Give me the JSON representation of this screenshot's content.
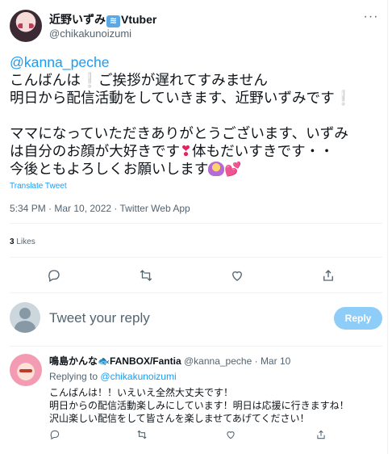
{
  "tweet": {
    "author_name": "近野いずみ",
    "author_suffix": "Vtuber",
    "author_emoji_icon": "water-wave-icon",
    "handle": "@chikakunoizumi",
    "body": {
      "mention": "@kanna_peche",
      "line1_a": "こんばんは",
      "line1_b": "ご挨拶が遅れてすみません",
      "line2_a": "明日から配信活動をしていきます、近野いずみです",
      "line3": "ママになっていただきありがとうございます、いずみ",
      "line4_a": "は自分のお顔が大好きです",
      "line4_b": "体もだいすきです・・",
      "line5": "今後ともよろしくお願いします"
    },
    "translate_label": "Translate Tweet",
    "timestamp": "5:34 PM · Mar 10, 2022 · Twitter Web App",
    "likes_count": "3",
    "likes_label": "Likes"
  },
  "reply_composer": {
    "placeholder": "Tweet your reply",
    "button_label": "Reply"
  },
  "reply": {
    "name": "鳴島かんな",
    "name_suffix": "FANBOX/Fantia",
    "handle": "@kanna_peche",
    "separator": "·",
    "date": "Mar 10",
    "replying_prefix": "Replying to",
    "replying_to": "@chikakunoizumi",
    "lines": [
      "こんばんは！！いえいえ全然大丈夫です！",
      "明日からの配信活動楽しみにしています！明日は応援に行きますね！",
      "沢山楽しい配信をして皆さんを楽しませてあげてください！"
    ]
  },
  "colors": {
    "accent": "#1d9bf0",
    "secondary_text": "#536471",
    "reply_button_disabled": "#8ecdf7",
    "divider": "#eff3f4"
  }
}
